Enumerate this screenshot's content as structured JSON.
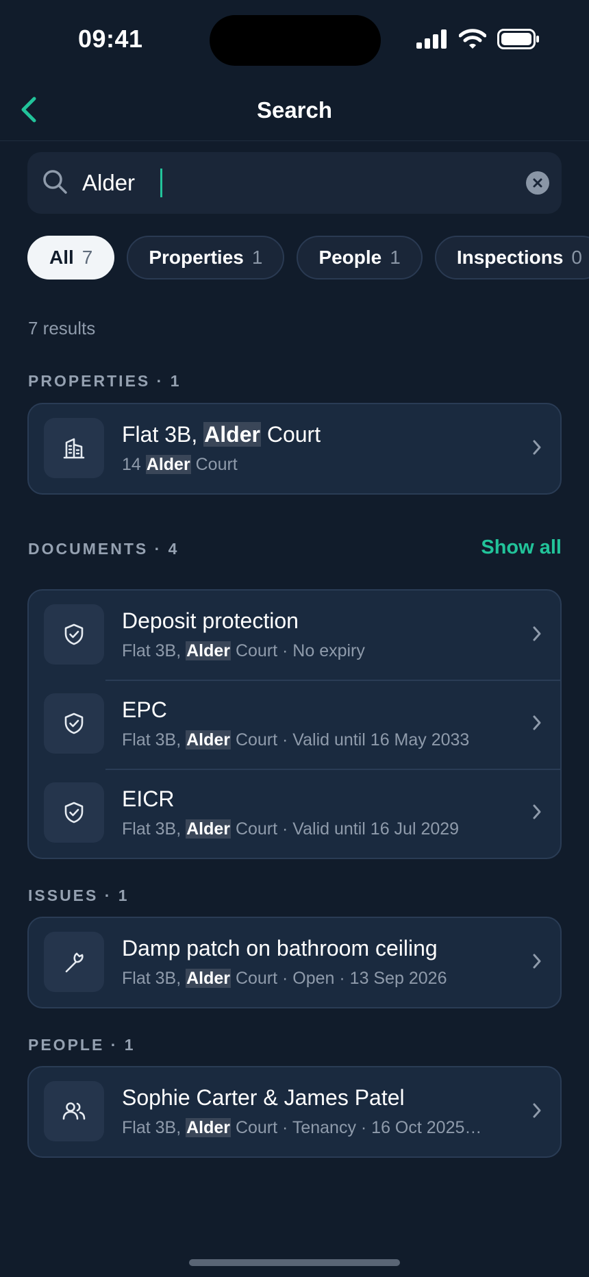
{
  "status": {
    "time": "09:41"
  },
  "nav": {
    "title": "Search"
  },
  "search": {
    "query": "Alder"
  },
  "chips": [
    {
      "label": "All",
      "count": "7"
    },
    {
      "label": "Properties",
      "count": "1"
    },
    {
      "label": "People",
      "count": "1"
    },
    {
      "label": "Inspections",
      "count": "0"
    }
  ],
  "results_count": "7 results",
  "sections": {
    "properties": {
      "label": "PROPERTIES · 1",
      "items": [
        {
          "title_pre": "Flat 3B, ",
          "title_hl": "Alder",
          "title_post": " Court",
          "sub_pre": "14 ",
          "sub_hl": "Alder",
          "sub_post": " Court",
          "icon": "building-icon"
        }
      ]
    },
    "documents": {
      "label": "DOCUMENTS · 4",
      "show_all": "Show all",
      "items": [
        {
          "title": "Deposit protection",
          "sub_pre": "Flat 3B, ",
          "sub_hl": "Alder",
          "sub_post": " Court · No expiry",
          "icon": "shield-check-icon"
        },
        {
          "title": "EPC",
          "sub_pre": "Flat 3B, ",
          "sub_hl": "Alder",
          "sub_post": " Court · Valid until 16 May 2033",
          "icon": "shield-check-icon"
        },
        {
          "title": "EICR",
          "sub_pre": "Flat 3B, ",
          "sub_hl": "Alder",
          "sub_post": " Court · Valid until 16 Jul 2029",
          "icon": "shield-check-icon"
        }
      ]
    },
    "issues": {
      "label": "ISSUES · 1",
      "items": [
        {
          "title": "Damp patch on bathroom ceiling",
          "sub_pre": "Flat 3B, ",
          "sub_hl": "Alder",
          "sub_post": " Court · Open · 13 Sep 2026",
          "icon": "wrench-icon"
        }
      ]
    },
    "people": {
      "label": "PEOPLE · 1",
      "items": [
        {
          "title": "Sophie Carter & James Patel",
          "sub_pre": "Flat 3B, ",
          "sub_hl": "Alder",
          "sub_post": " Court · Tenancy · 16 Oct 2025…",
          "icon": "people-icon"
        }
      ]
    }
  },
  "colors": {
    "accent": "#22c39a",
    "background": "#111c2b",
    "card": "#1a2a3f"
  }
}
